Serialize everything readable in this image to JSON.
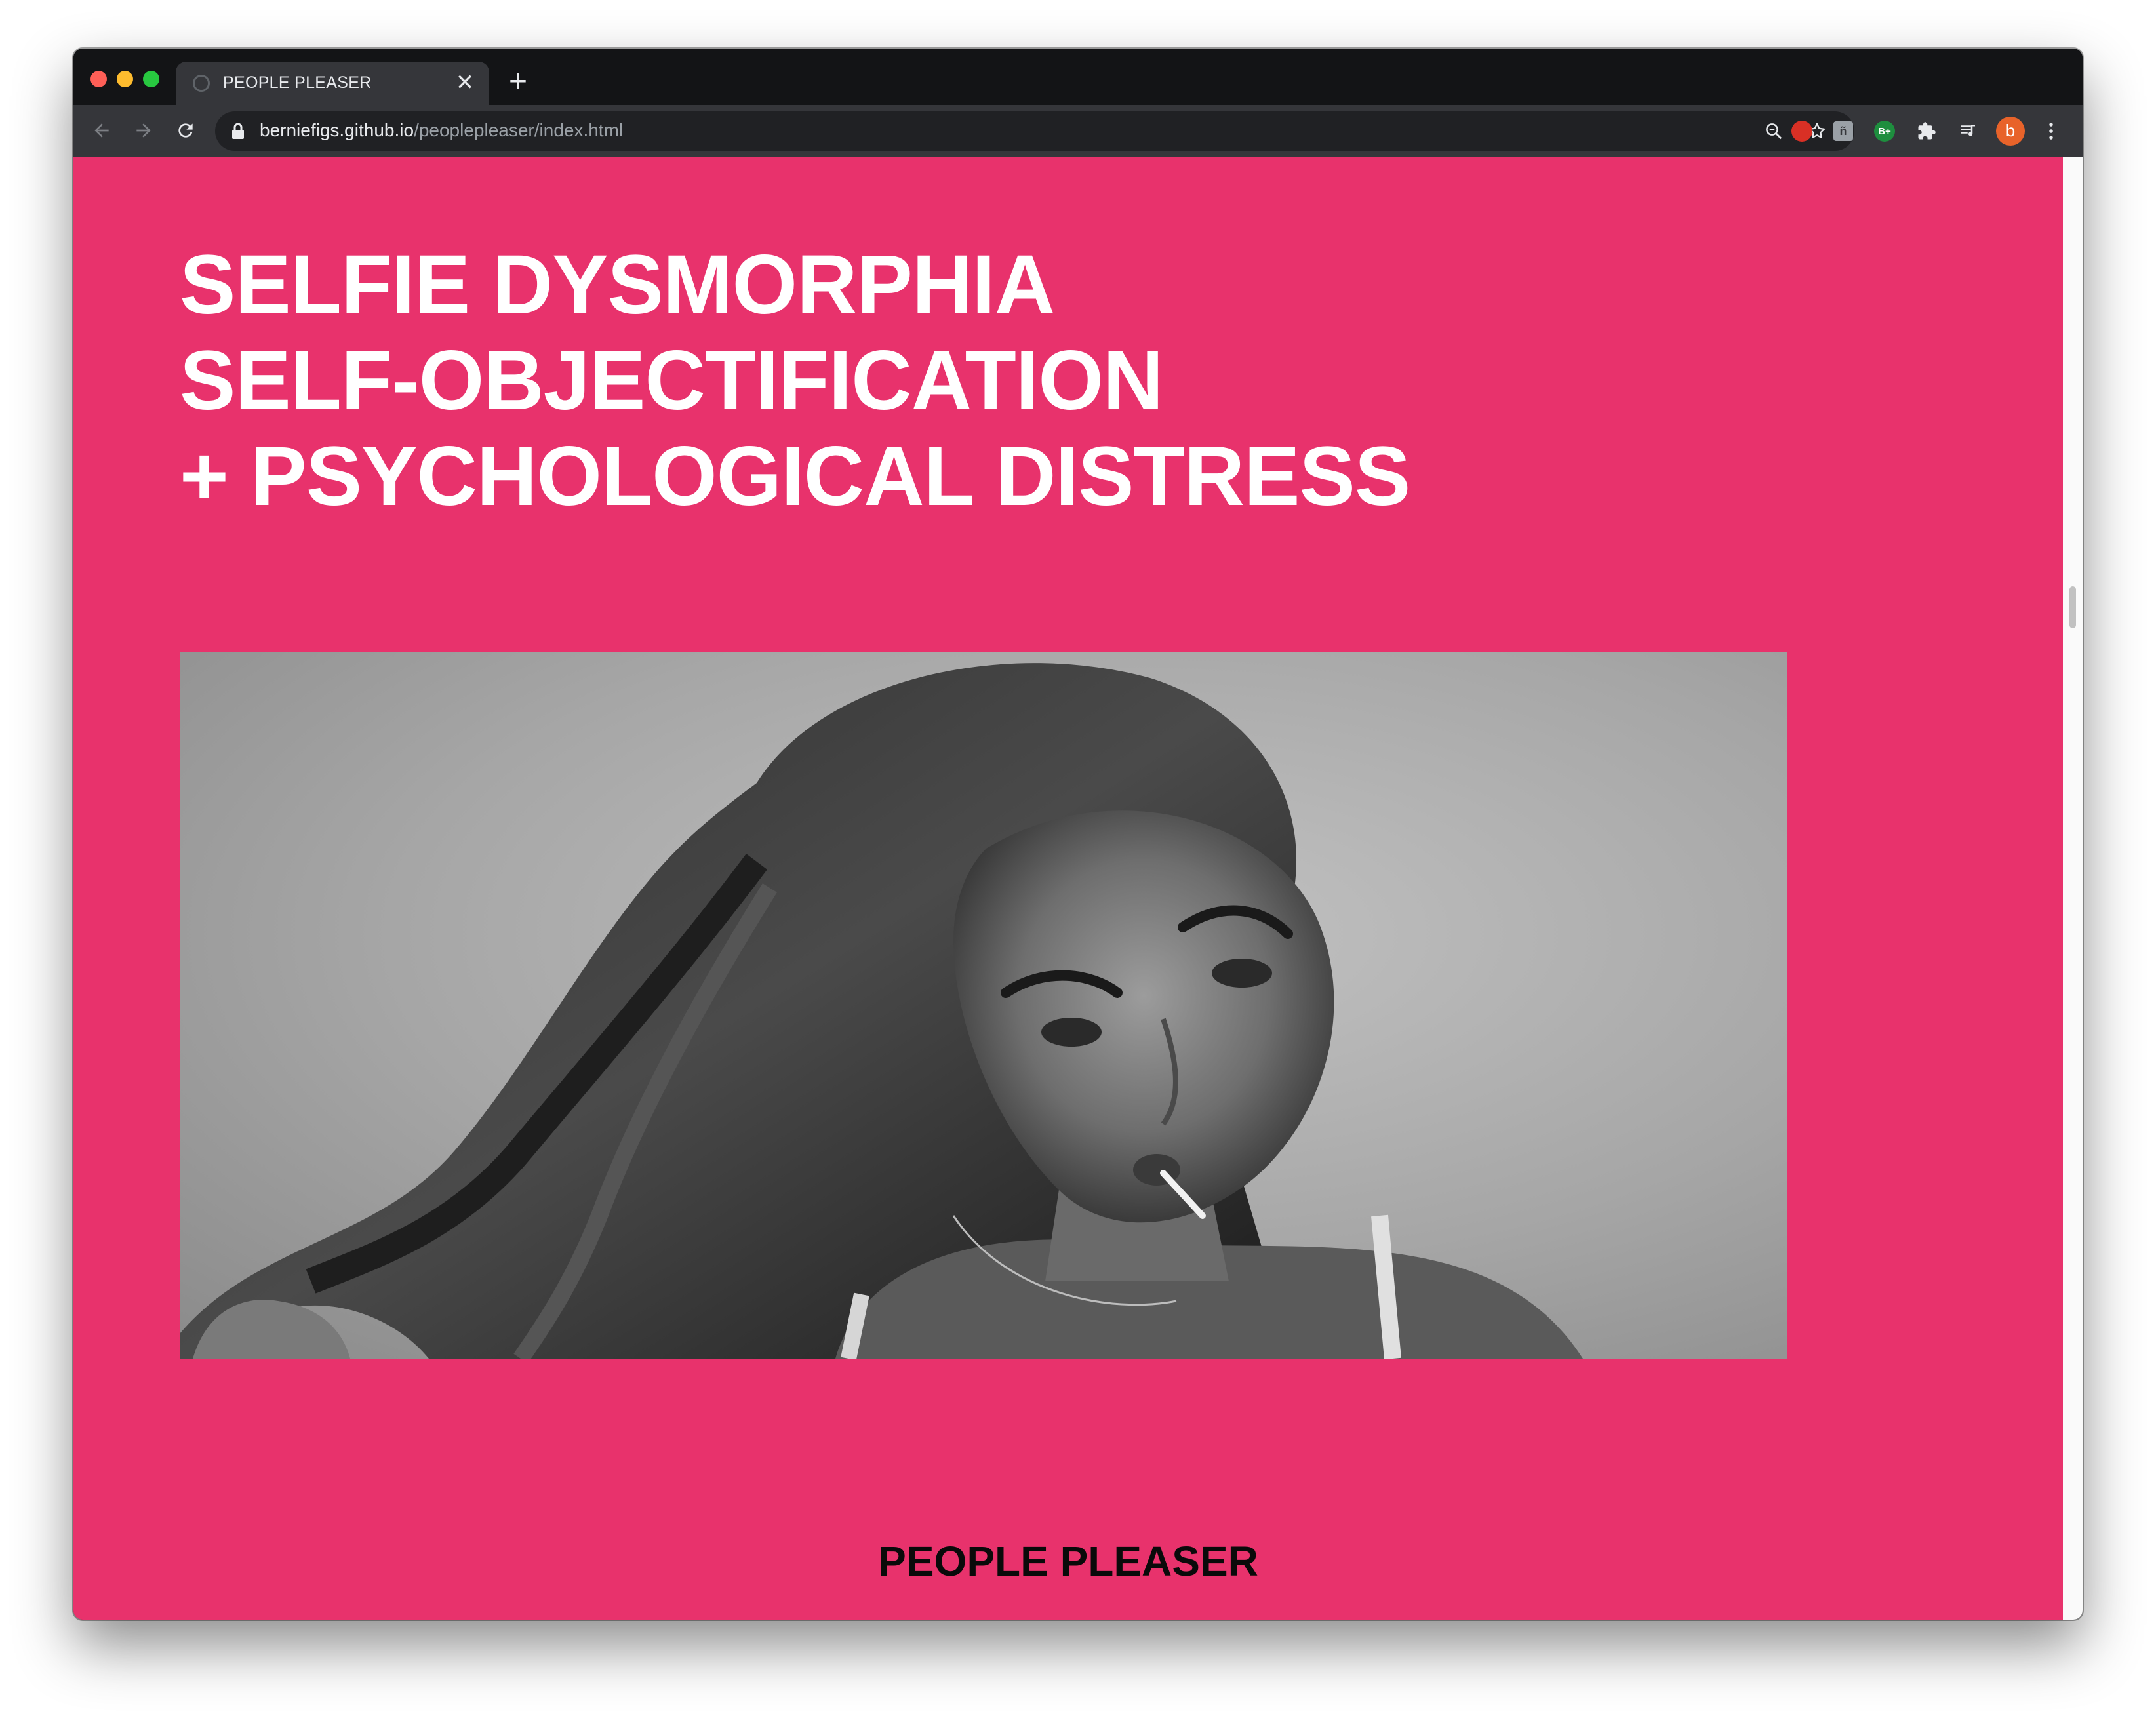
{
  "browser": {
    "tab_title": "PEOPLE PLEASER",
    "tab_close_glyph": "✕",
    "new_tab_glyph": "+",
    "url_host": "berniefigs.github.io",
    "url_path": "/peoplepleaser/index.html",
    "profile_initial": "b",
    "extensions": [
      {
        "name": "blocker-extension",
        "color": "#d93025"
      },
      {
        "name": "reader-extension",
        "label": "ñ"
      },
      {
        "name": "grade-extension",
        "label": "B+"
      }
    ]
  },
  "page": {
    "background": "#e8326c",
    "headline_lines": [
      "SELFIE DYSMORPHIA",
      "SELF-OBJECTIFICATION",
      "+ PSYCHOLOGICAL DISTRESS"
    ],
    "photo": {
      "icon": "portrait-photo",
      "style": "black-and-white"
    },
    "footer_logo": "PEOPLE PLEASER"
  }
}
